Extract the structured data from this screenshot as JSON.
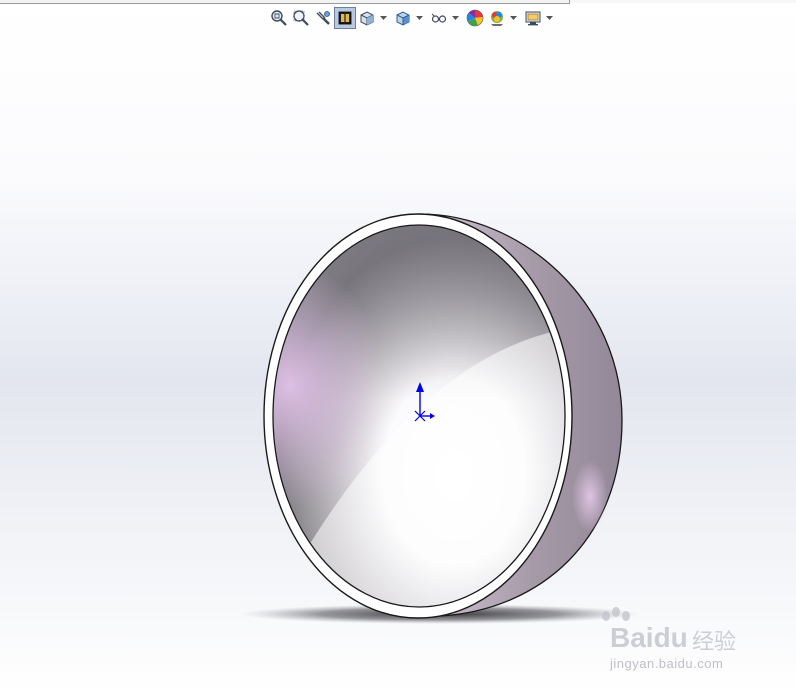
{
  "toolbar": {
    "buttons": [
      {
        "icon": "zoom-to-fit-icon",
        "active": false,
        "dropdown": false
      },
      {
        "icon": "zoom-to-area-icon",
        "active": false,
        "dropdown": false
      },
      {
        "icon": "previous-view-icon",
        "active": false,
        "dropdown": false
      },
      {
        "icon": "section-view-icon",
        "active": true,
        "dropdown": false
      },
      {
        "icon": "view-orientation-icon",
        "active": false,
        "dropdown": true
      },
      {
        "icon": "display-style-icon",
        "active": false,
        "dropdown": true
      },
      {
        "icon": "hide-show-items-icon",
        "active": false,
        "dropdown": true
      },
      {
        "icon": "edit-appearance-icon",
        "active": false,
        "dropdown": false
      },
      {
        "icon": "apply-scene-icon",
        "active": false,
        "dropdown": true
      },
      {
        "icon": "view-settings-icon",
        "active": false,
        "dropdown": true
      }
    ]
  },
  "model": {
    "shape": "hemispherical-dish",
    "colors": {
      "rim": "#ffffff",
      "outline": "#1a1a1a",
      "inner_dark": "#7d7b80",
      "inner_light": "#ffffff",
      "inner_tint": "#dcbfe0",
      "outer_shell": "#c9c0cb",
      "triad": "#0000ee"
    }
  },
  "watermark": {
    "brand": "Bai",
    "brand_suffix": "du",
    "cn": "经验",
    "url": "jingyan.baidu.com"
  }
}
